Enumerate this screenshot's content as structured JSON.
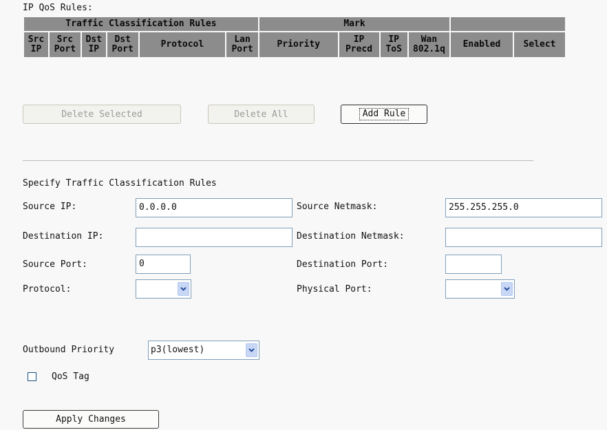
{
  "page_title": "IP QoS Rules:",
  "table": {
    "group_headers": [
      "Traffic Classification Rules",
      "Mark",
      ""
    ],
    "columns": [
      {
        "l1": "Src",
        "l2": "IP"
      },
      {
        "l1": "Src",
        "l2": "Port"
      },
      {
        "l1": "Dst",
        "l2": "IP"
      },
      {
        "l1": "Dst",
        "l2": "Port"
      },
      {
        "l1": "Protocol",
        "l2": ""
      },
      {
        "l1": "Lan",
        "l2": "Port"
      },
      {
        "l1": "Priority",
        "l2": ""
      },
      {
        "l1": "IP",
        "l2": "Precd"
      },
      {
        "l1": "IP",
        "l2": "ToS"
      },
      {
        "l1": "Wan",
        "l2": "802.1q"
      },
      {
        "l1": "Enabled",
        "l2": ""
      },
      {
        "l1": "Select",
        "l2": ""
      }
    ]
  },
  "buttons": {
    "delete_selected": "Delete Selected",
    "delete_all": "Delete All",
    "add_rule": "Add Rule",
    "apply_changes": "Apply Changes"
  },
  "form": {
    "section_title": "Specify Traffic Classification Rules",
    "source_ip_label": "Source IP:",
    "source_ip_value": "0.0.0.0",
    "source_netmask_label": "Source Netmask:",
    "source_netmask_value": "255.255.255.0",
    "destination_ip_label": "Destination IP:",
    "destination_ip_value": "",
    "destination_netmask_label": "Destination Netmask:",
    "destination_netmask_value": "",
    "source_port_label": "Source Port:",
    "source_port_value": "0",
    "destination_port_label": "Destination Port:",
    "destination_port_value": "",
    "protocol_label": "Protocol:",
    "protocol_value": "",
    "physical_port_label": "Physical Port:",
    "physical_port_value": "",
    "outbound_priority_label": "Outbound Priority",
    "outbound_priority_value": "p3(lowest)",
    "qos_tag_label": "QoS Tag",
    "qos_tag_checked": false
  },
  "icons": {
    "dropdown": "chevron-down-icon",
    "checkbox": "checkbox-icon"
  },
  "colors": {
    "header_bg": "#8c8c8c",
    "input_border": "#7f9db9",
    "dropdown_button": "#c7d7f5"
  }
}
